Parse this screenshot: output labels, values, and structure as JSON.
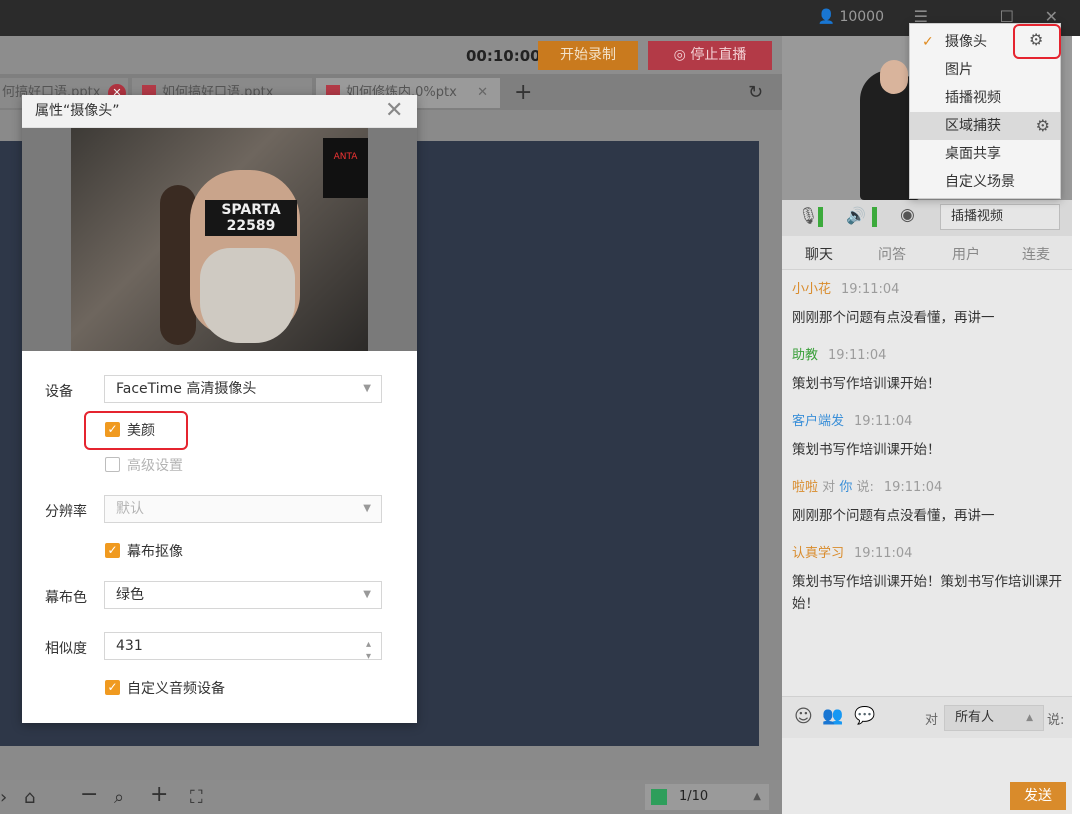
{
  "titlebar": {
    "user_count": "10000"
  },
  "topbar": {
    "timer": "00:10:00",
    "start_record": "开始录制",
    "stop_live": "停止直播"
  },
  "tabs": [
    {
      "label": "何搞好口语.pptx"
    },
    {
      "label": "如何搞好口语.pptx"
    },
    {
      "label": "如何修炼内.0%ptx"
    }
  ],
  "bottombar": {
    "page": "1/10"
  },
  "source_menu": {
    "items": [
      "摄像头",
      "图片",
      "插播视频",
      "区域捕获",
      "桌面共享",
      "自定义场景"
    ],
    "selected": "摄像头",
    "highlighted": "区域捕获"
  },
  "controls": {
    "source_select": "插播视频"
  },
  "chat_tabs": [
    "聊天",
    "问答",
    "用户",
    "连麦"
  ],
  "chat": [
    {
      "user": "小小花",
      "user_color": "#d98b2b",
      "time": "19:11:04",
      "text": "刚刚那个问题有点没看懂，再讲一"
    },
    {
      "user": "助教",
      "user_color": "#3aa03a",
      "time": "19:11:04",
      "text": "策划书写作培训课开始！"
    },
    {
      "user": "客户端发",
      "user_color": "#3a8fd8",
      "time": "19:11:04",
      "text": "策划书写作培训课开始！"
    },
    {
      "user": "啦啦",
      "user_color": "#d98b2b",
      "to_word": "对",
      "to_user": "你",
      "say": "说:",
      "time": "19:11:04",
      "text": "刚刚那个问题有点没看懂，再讲一"
    },
    {
      "user": "认真学习",
      "user_color": "#d98b2b",
      "time": "19:11:04",
      "text": "策划书写作培训课开始！策划书写作培训课开始！"
    }
  ],
  "input": {
    "to_label": "对",
    "to_select": "所有人",
    "say_label": "说:",
    "send": "发送"
  },
  "dialog": {
    "title": "属性“摄像头”",
    "device_label": "设备",
    "device_value": "FaceTime 高清摄像头",
    "beauty": "美颜",
    "advanced": "高级设置",
    "resolution_label": "分辨率",
    "resolution_value": "默认",
    "chroma": "幕布抠像",
    "chroma_color_label": "幕布色",
    "chroma_color_value": "绿色",
    "similarity_label": "相似度",
    "similarity_value": "431",
    "custom_audio": "自定义音频设备",
    "photo_headband": "SPARTA 22589",
    "photo_logo": "ANTA"
  }
}
